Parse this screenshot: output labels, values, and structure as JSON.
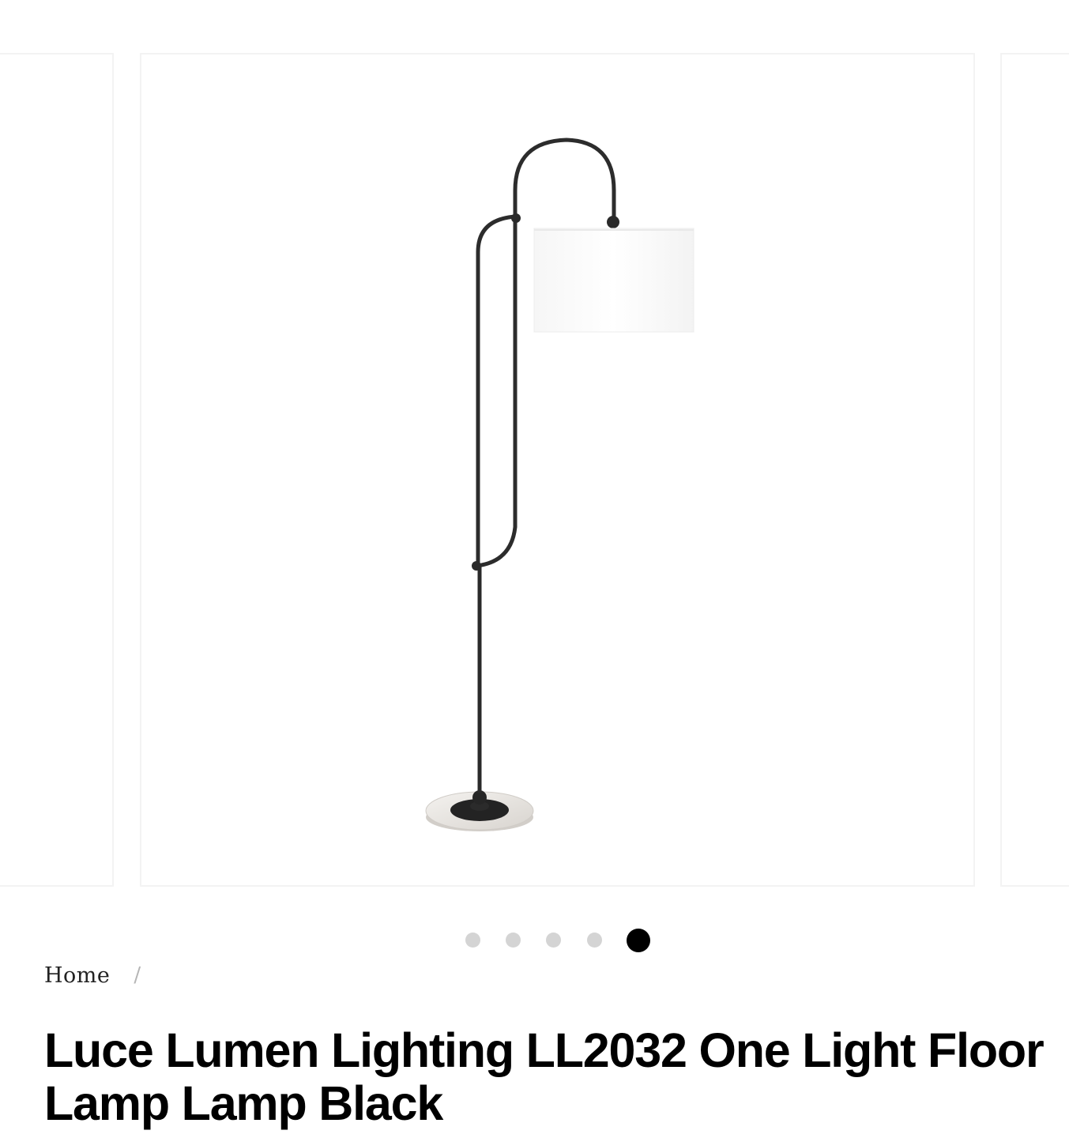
{
  "gallery": {
    "image_alt": "Luce Lumen Lighting LL2032 One Light Floor Lamp Lamp Black",
    "slide_count": 5,
    "active_slide": 5,
    "colors": {
      "active_dot": "#000000",
      "inactive_dot": "#d4d4d4",
      "slide_border": "#f3f3f3"
    }
  },
  "breadcrumb": {
    "home_label": "Home",
    "separator": "/"
  },
  "product": {
    "title": "Luce Lumen Lighting LL2032 One Light Floor Lamp Lamp Black"
  }
}
